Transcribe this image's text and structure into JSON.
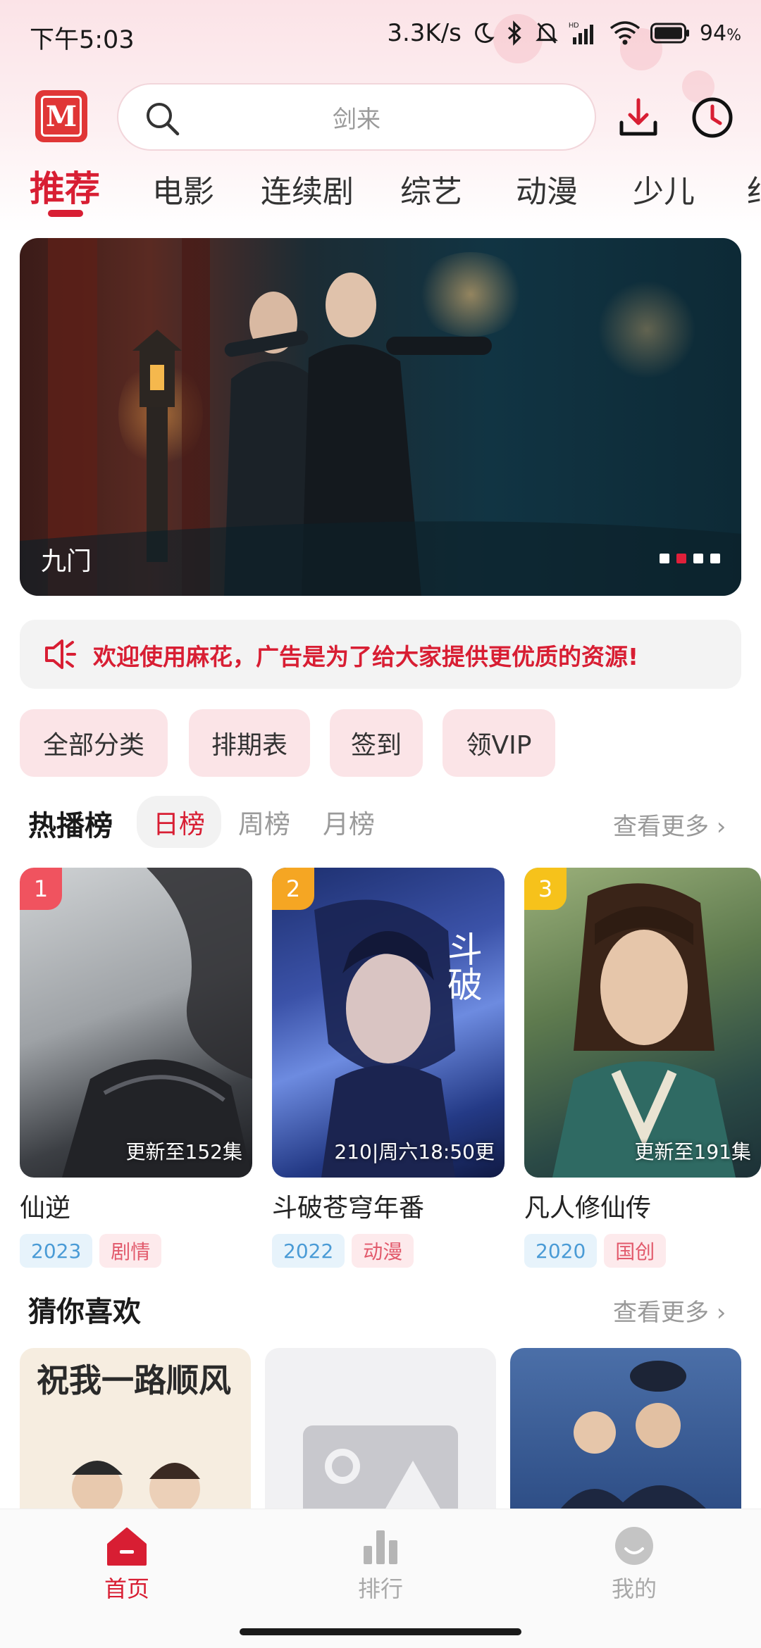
{
  "status_bar": {
    "time": "下午5:03",
    "net_speed": "3.3K/s",
    "battery": "94"
  },
  "header": {
    "logo_letter": "M",
    "search_placeholder": "剑来"
  },
  "tabs": [
    "推荐",
    "电影",
    "连续剧",
    "综艺",
    "动漫",
    "少儿"
  ],
  "banner": {
    "title": "九门",
    "page_count": 4,
    "active_page": 2
  },
  "notice": {
    "text": "欢迎使用麻花，广告是为了给大家提供更优质的资源!"
  },
  "chips": [
    "全部分类",
    "排期表",
    "签到",
    "领VIP"
  ],
  "hot": {
    "title": "热播榜",
    "tabs": [
      "日榜",
      "周榜",
      "月榜"
    ],
    "more": "查看更多 ›",
    "items": [
      {
        "rank": "1",
        "update": "更新至152集",
        "title": "仙逆",
        "year": "2023",
        "genre": "剧情"
      },
      {
        "rank": "2",
        "update": "210|周六18:50更",
        "title": "斗破苍穹年番",
        "year": "2022",
        "genre": "动漫"
      },
      {
        "rank": "3",
        "update": "更新至191集",
        "title": "凡人修仙传",
        "year": "2020",
        "genre": "国创"
      }
    ]
  },
  "guess": {
    "title": "猜你喜欢",
    "more": "查看更多 ›",
    "first_poster_text": "祝我一路顺风"
  },
  "colors": {
    "accent": "#d81e33",
    "rank1": "#f0535f",
    "rank2": "#f5a623",
    "rank3": "#f6c21b"
  },
  "bottom_nav": [
    {
      "label": "首页"
    },
    {
      "label": "排行"
    },
    {
      "label": "我的"
    }
  ]
}
